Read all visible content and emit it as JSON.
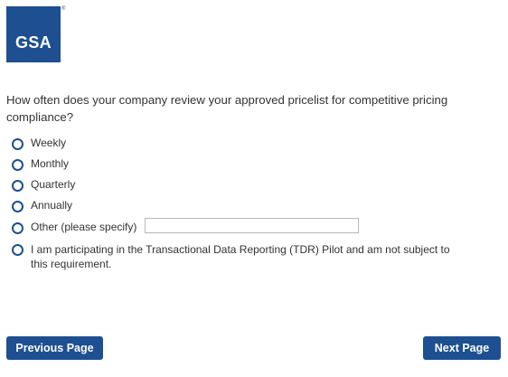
{
  "logo": {
    "text": "GSA",
    "registered_mark": "®"
  },
  "survey": {
    "question": "How often does your company review your approved pricelist for competitive pricing compliance?",
    "options": [
      {
        "label": "Weekly"
      },
      {
        "label": "Monthly"
      },
      {
        "label": "Quarterly"
      },
      {
        "label": "Annually"
      },
      {
        "label": "Other (please specify)",
        "input_value": ""
      },
      {
        "label": "I am participating in the Transactional Data Reporting (TDR) Pilot and am not subject to this requirement."
      }
    ]
  },
  "navigation": {
    "previous_label": "Previous Page",
    "next_label": "Next Page"
  },
  "colors": {
    "brand_blue": "#1d4f91",
    "text": "#333333"
  }
}
